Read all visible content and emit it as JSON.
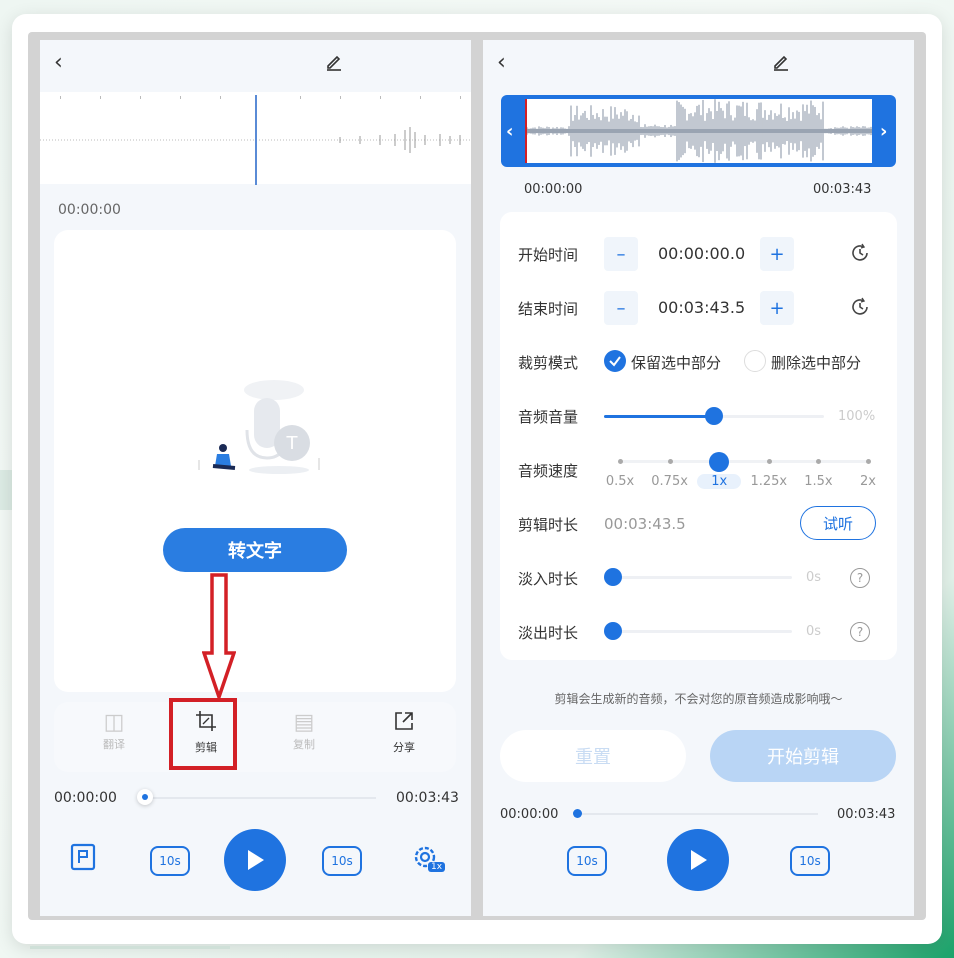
{
  "left": {
    "current_time": "00:00:00",
    "convert_button": "转文字",
    "tools": [
      {
        "label": "翻译",
        "icon": "translate-icon",
        "active": false
      },
      {
        "label": "剪辑",
        "icon": "crop-icon",
        "active": true
      },
      {
        "label": "复制",
        "icon": "copy-icon",
        "active": false
      },
      {
        "label": "分享",
        "icon": "share-icon",
        "active": true
      }
    ],
    "player": {
      "start": "00:00:00",
      "end": "00:03:43",
      "skip_back": "10s",
      "skip_fwd": "10s",
      "speed_badge": "1x"
    }
  },
  "right": {
    "wave_start": "00:00:00",
    "wave_end": "00:03:43",
    "start_label": "开始时间",
    "start_value": "00:00:00.0",
    "end_label": "结束时间",
    "end_value": "00:03:43.5",
    "mode_label": "裁剪模式",
    "mode_keep": "保留选中部分",
    "mode_delete": "删除选中部分",
    "volume_label": "音频音量",
    "volume_value": "100%",
    "volume_level": 0.5,
    "speed_label": "音频速度",
    "speeds": [
      "0.5x",
      "0.75x",
      "1x",
      "1.25x",
      "1.5x",
      "2x"
    ],
    "speed_selected": "1x",
    "duration_label": "剪辑时长",
    "duration_value": "00:03:43.5",
    "preview_button": "试听",
    "fadein_label": "淡入时长",
    "fadein_value": "0s",
    "fadeout_label": "淡出时长",
    "fadeout_value": "0s",
    "notice": "剪辑会生成新的音频，不会对您的原音频造成影响哦～",
    "reset_button": "重置",
    "start_button": "开始剪辑",
    "player": {
      "start": "00:00:00",
      "end": "00:03:43",
      "skip_back": "10s",
      "skip_fwd": "10s"
    }
  },
  "colors": {
    "accent": "#1f73e0",
    "highlight": "#d32026"
  }
}
